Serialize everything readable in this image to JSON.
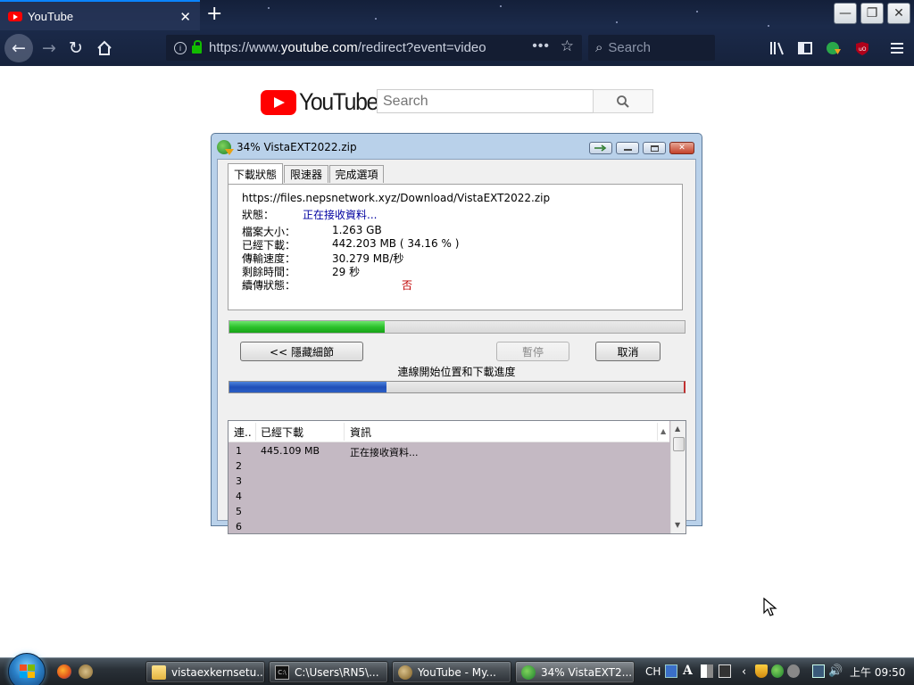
{
  "browser": {
    "tab_title": "YouTube",
    "tab_close": "✕",
    "new_tab": "+",
    "url_prefix": "https://www.",
    "url_domain": "youtube.com",
    "url_rest": "/redirect?event=video",
    "search_placeholder": "Search",
    "window_buttons": {
      "minimize": "—",
      "restore": "❐",
      "close": "✕"
    }
  },
  "youtube": {
    "wordmark": "YouTube",
    "search_placeholder": "Search"
  },
  "idm": {
    "title": "34% VistaEXT2022.zip",
    "tabs": [
      "下載狀態",
      "限速器",
      "完成選項"
    ],
    "url": "https://files.nepsnetwork.xyz/Download/VistaEXT2022.zip",
    "status_label": "狀態：",
    "status_value": "正在接收資料...",
    "file_size_label": "檔案大小：",
    "file_size_value": "1.263  GB",
    "downloaded_label": "已經下載：",
    "downloaded_value": "442.203  MB  ( 34.16 % )",
    "speed_label": "傳輸速度：",
    "speed_value": "30.279  MB/秒",
    "remaining_label": "剩餘時間：",
    "remaining_value": "29 秒",
    "resume_label": "續傳狀態：",
    "resume_value": "否",
    "progress_fraction": 0.3416,
    "segment_fraction": 0.345,
    "buttons": {
      "hide_details": "<< 隱藏細節",
      "pause": "暫停",
      "cancel": "取消"
    },
    "segments_caption": "連線開始位置和下載進度",
    "columns": [
      "連..",
      "已經下載",
      "資訊"
    ],
    "connections": [
      {
        "id": "1",
        "downloaded": "445.109  MB",
        "info": "正在接收資料..."
      },
      {
        "id": "2",
        "downloaded": "",
        "info": ""
      },
      {
        "id": "3",
        "downloaded": "",
        "info": ""
      },
      {
        "id": "4",
        "downloaded": "",
        "info": ""
      },
      {
        "id": "5",
        "downloaded": "",
        "info": ""
      },
      {
        "id": "6",
        "downloaded": "",
        "info": ""
      }
    ]
  },
  "taskbar": {
    "items": [
      {
        "label": "vistaexkernsetu...",
        "icon": "folder-icon"
      },
      {
        "label": "C:\\Users\\RN5\\...",
        "icon": "cmd-icon"
      },
      {
        "label": "YouTube - My...",
        "icon": "browser-icon"
      },
      {
        "label": "34% VistaEXT2...",
        "icon": "idm-icon"
      }
    ],
    "language": "CH",
    "clock": "上午 09:50"
  },
  "colors": {
    "youtube_red": "#ff0000",
    "idm_progress_green": "#2cc22c",
    "idm_segment_blue": "#1f4fb8",
    "status_blue": "#0000a0",
    "resume_red": "#c00000",
    "connection_list_bg": "#c4b9c3"
  }
}
